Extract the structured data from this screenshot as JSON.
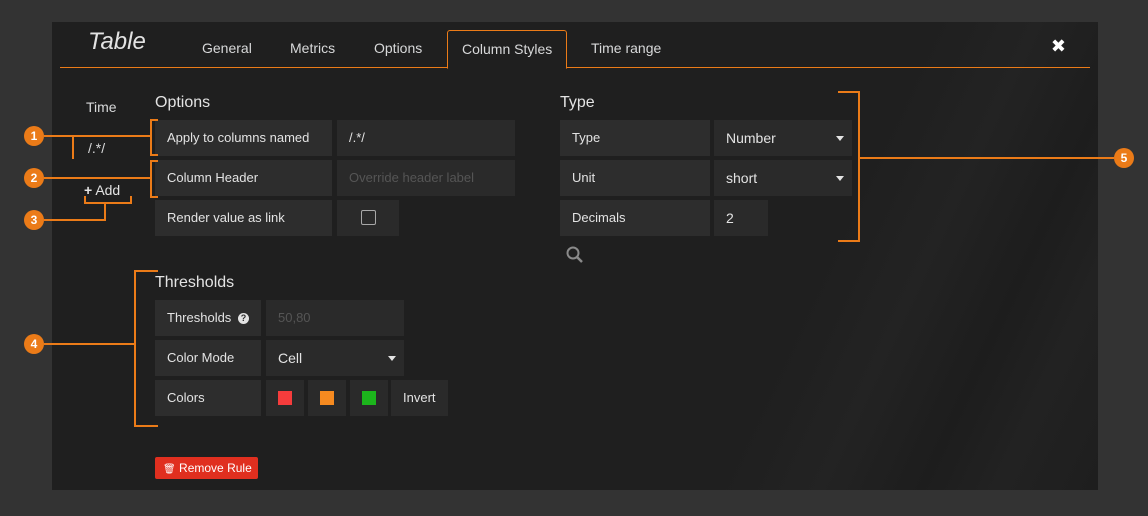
{
  "panel": {
    "title": "Table",
    "close_symbol": "✖"
  },
  "tabs": [
    {
      "label": "General"
    },
    {
      "label": "Metrics"
    },
    {
      "label": "Options"
    },
    {
      "label": "Column Styles",
      "active": true
    },
    {
      "label": "Time range"
    }
  ],
  "column_list": {
    "header": "Time",
    "selected": "/.*/",
    "add_label": "Add"
  },
  "options": {
    "title": "Options",
    "apply_label": "Apply to columns named",
    "apply_value": "/.*/",
    "header_label": "Column Header",
    "header_placeholder": "Override header label",
    "link_label": "Render value as link"
  },
  "type_section": {
    "title": "Type",
    "type_label": "Type",
    "type_value": "Number",
    "unit_label": "Unit",
    "unit_value": "short",
    "decimals_label": "Decimals",
    "decimals_value": "2"
  },
  "thresholds": {
    "title": "Thresholds",
    "thresholds_label": "Thresholds",
    "thresholds_placeholder": "50,80",
    "color_mode_label": "Color Mode",
    "color_mode_value": "Cell",
    "colors_label": "Colors",
    "colors": [
      "#f53c3c",
      "#f58a20",
      "#1cb51c"
    ],
    "invert_label": "Invert"
  },
  "remove_rule_label": "Remove Rule",
  "annotations": [
    "1",
    "2",
    "3",
    "4",
    "5"
  ],
  "accent_color": "#eb7b18"
}
